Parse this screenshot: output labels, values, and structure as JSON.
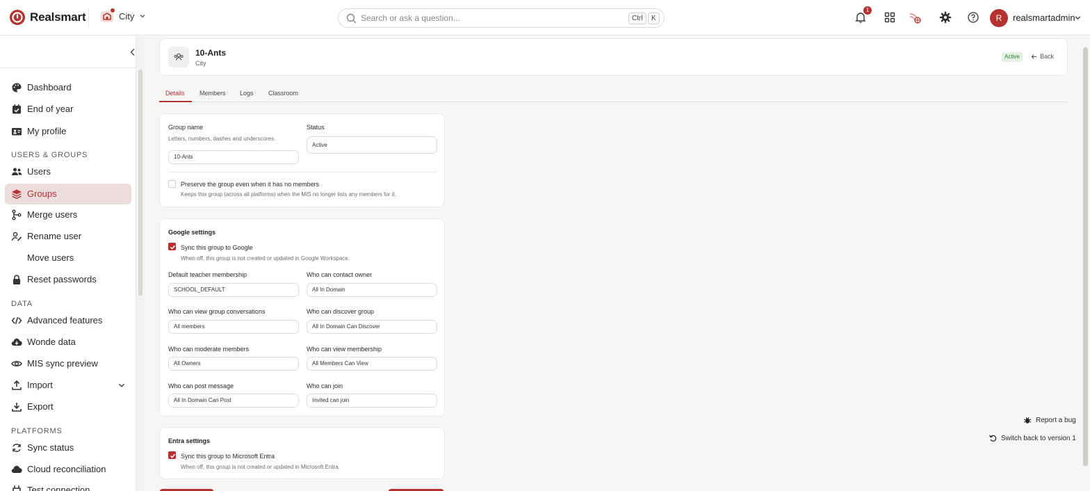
{
  "topbar": {
    "brand": "Realsmart",
    "tenant": "City",
    "search_placeholder": "Search or ask a question...",
    "kbd_ctrl": "Ctrl",
    "kbd_k": "K",
    "notification_count": "1",
    "avatar_initial": "R",
    "username": "realsmartadmin"
  },
  "sidebar": {
    "items_top": [
      {
        "label": "Dashboard",
        "icon": "palette-icon"
      },
      {
        "label": "End of year",
        "icon": "calendar-check-icon"
      },
      {
        "label": "My profile",
        "icon": "id-card-icon"
      }
    ],
    "section_users": "USERS & GROUPS",
    "items_users": [
      {
        "label": "Users",
        "icon": "users-icon"
      },
      {
        "label": "Groups",
        "icon": "layers-icon",
        "active": true
      },
      {
        "label": "Merge users",
        "icon": "merge-icon"
      },
      {
        "label": "Rename user",
        "icon": "user-edit-icon"
      },
      {
        "label": "Move users",
        "icon": ""
      },
      {
        "label": "Reset passwords",
        "icon": "lock-icon"
      }
    ],
    "section_data": "DATA",
    "items_data": [
      {
        "label": "Advanced features",
        "icon": "code-icon"
      },
      {
        "label": "Wonde data",
        "icon": "cloud-download-icon"
      },
      {
        "label": "MIS sync preview",
        "icon": "eye-icon"
      },
      {
        "label": "Import",
        "icon": "upload-icon"
      },
      {
        "label": "Export",
        "icon": "download-icon"
      }
    ],
    "section_platforms": "PLATFORMS",
    "items_platforms": [
      {
        "label": "Sync status",
        "icon": "sync-icon"
      },
      {
        "label": "Cloud reconciliation",
        "icon": "cloud-icon"
      },
      {
        "label": "Test connection",
        "icon": "plug-icon"
      }
    ]
  },
  "header": {
    "title": "10-Ants",
    "subtitle": "City",
    "status": "Active",
    "back": "Back"
  },
  "tabs": [
    "Details",
    "Members",
    "Logs",
    "Classroom"
  ],
  "details": {
    "group_name_label": "Group name",
    "group_name_hint": "Letters, numbers, dashes and underscores.",
    "group_name_value": "10-Ants",
    "status_label": "Status",
    "status_value": "Active",
    "preserve_label": "Preserve the group even when it has no members",
    "preserve_hint": "Keeps this group (across all platforms) when the MIS no longer lists any members for it.",
    "preserve_checked": false
  },
  "google": {
    "title": "Google settings",
    "sync_label": "Sync this group to Google",
    "sync_hint": "When off, this group is not created or updated in Google Workspace.",
    "sync_checked": true,
    "fields": [
      {
        "label": "Default teacher membership",
        "value": "SCHOOL_DEFAULT"
      },
      {
        "label": "Who can contact owner",
        "value": "All In Domain"
      },
      {
        "label": "Who can view group conversations",
        "value": "All members"
      },
      {
        "label": "Who can discover group",
        "value": "All In Domain Can Discover"
      },
      {
        "label": "Who can moderate members",
        "value": "All Owners"
      },
      {
        "label": "Who can view membership",
        "value": "All Members Can View"
      },
      {
        "label": "Who can post message",
        "value": "All In Domain Can Post"
      },
      {
        "label": "Who can join",
        "value": "Invited can join"
      }
    ]
  },
  "entra": {
    "title": "Entra settings",
    "sync_label": "Sync this group to Microsoft Entra",
    "sync_hint": "When off, this group is not created or updated in Microsoft Entra.",
    "sync_checked": true
  },
  "floating": {
    "report_bug": "Report a bug",
    "switch_version": "Switch back to version 1"
  },
  "colors": {
    "accent": "#b4322f",
    "active_nav_bg": "#ecdcdc",
    "status_green": "#2e7d32"
  }
}
